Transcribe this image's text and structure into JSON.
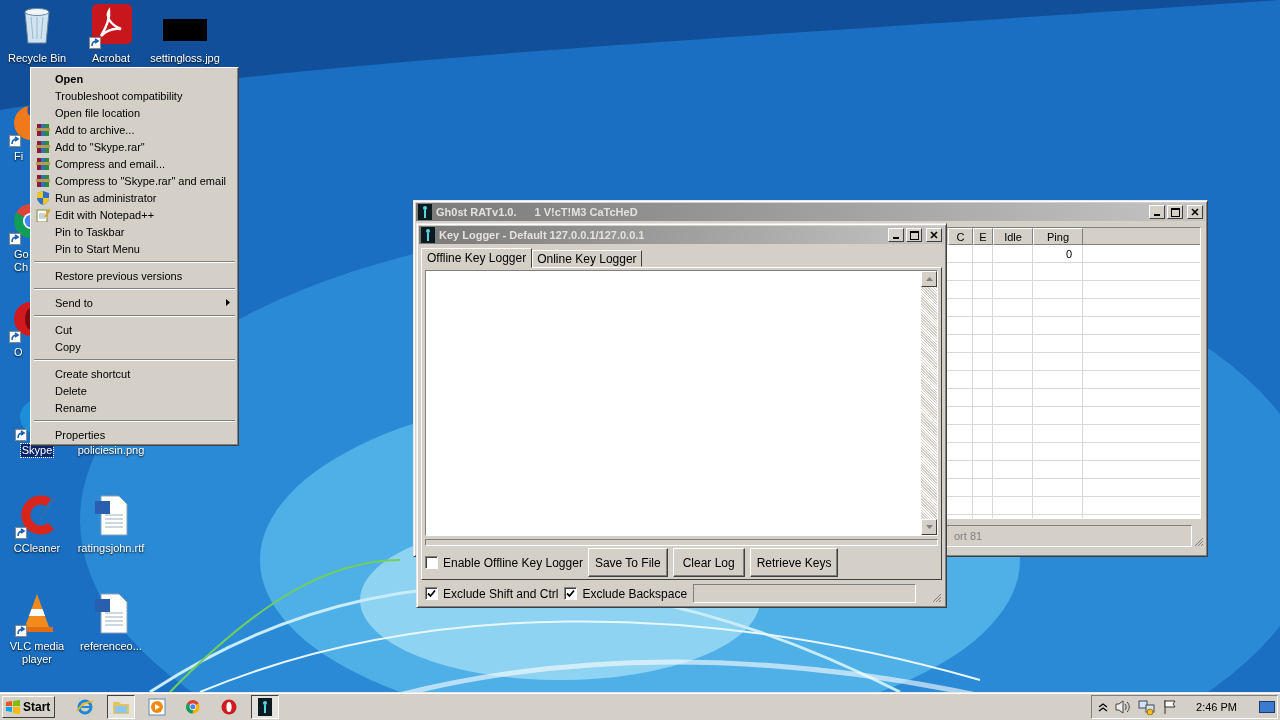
{
  "desktop": {
    "icons": [
      {
        "label": "Recycle Bin",
        "kind": "bin",
        "shortcut": false,
        "selected": false
      },
      {
        "label": "Acrobat",
        "kind": "pdf",
        "shortcut": true,
        "selected": false
      },
      {
        "label": "settingloss.jpg",
        "kind": "thumb",
        "shortcut": false,
        "selected": false
      },
      {
        "label": "Fi",
        "kind": "fox",
        "shortcut": true,
        "selected": false
      },
      {
        "label": "Go Ch",
        "kind": "chrome",
        "shortcut": true,
        "selected": false
      },
      {
        "label": "O",
        "kind": "opera",
        "shortcut": true,
        "selected": false
      },
      {
        "label": "Skype",
        "kind": "skype",
        "shortcut": true,
        "selected": true
      },
      {
        "label": "policiesin.png",
        "kind": "imagefile",
        "shortcut": false,
        "selected": false
      },
      {
        "label": "CCleaner",
        "kind": "ccleaner",
        "shortcut": true,
        "selected": false
      },
      {
        "label": "ratingsjohn.rtf",
        "kind": "document",
        "shortcut": false,
        "selected": false
      },
      {
        "label": "VLC media player",
        "kind": "cone",
        "shortcut": true,
        "selected": false
      },
      {
        "label": "referenceo...",
        "kind": "document",
        "shortcut": false,
        "selected": false
      }
    ]
  },
  "context_menu": {
    "items": [
      {
        "kind": "default",
        "label": "Open"
      },
      {
        "kind": "plain",
        "label": "Troubleshoot compatibility"
      },
      {
        "kind": "plain",
        "label": "Open file location"
      },
      {
        "kind": "archive",
        "label": "Add to archive..."
      },
      {
        "kind": "archive",
        "label": "Add to \"Skype.rar\""
      },
      {
        "kind": "archive",
        "label": "Compress and email..."
      },
      {
        "kind": "archive",
        "label": "Compress to \"Skype.rar\" and email"
      },
      {
        "kind": "elevated",
        "label": "Run as administrator"
      },
      {
        "kind": "editor",
        "label": "Edit with Notepad++"
      },
      {
        "kind": "plain",
        "label": "Pin to Taskbar"
      },
      {
        "kind": "plain",
        "label": "Pin to Start Menu"
      },
      {
        "kind": "separator"
      },
      {
        "kind": "plain",
        "label": "Restore previous versions"
      },
      {
        "kind": "separator"
      },
      {
        "kind": "submenu",
        "label": "Send to"
      },
      {
        "kind": "separator"
      },
      {
        "kind": "plain",
        "label": "Cut"
      },
      {
        "kind": "plain",
        "label": "Copy"
      },
      {
        "kind": "separator"
      },
      {
        "kind": "plain",
        "label": "Create shortcut"
      },
      {
        "kind": "plain",
        "label": "Delete"
      },
      {
        "kind": "plain",
        "label": "Rename"
      },
      {
        "kind": "separator"
      },
      {
        "kind": "plain",
        "label": "Properties"
      }
    ]
  },
  "main_window": {
    "title": "Gh0st RATv1.0.",
    "caption": "1 V!cT!M3 CaTcHeD",
    "table": {
      "columns": [
        "C",
        "E",
        "Idle",
        "Ping"
      ],
      "rows": [
        {
          "cells": [
            null,
            null,
            null,
            "0"
          ]
        }
      ]
    },
    "status_bar": "ort 81"
  },
  "keylogger_window": {
    "title": "Key Logger - Default 127.0.0.1/127.0.0.1",
    "tabs": [
      {
        "label": "Offline Key Logger",
        "selected": true
      },
      {
        "label": "Online Key Logger",
        "selected": false
      }
    ],
    "enable_checkbox": {
      "label": "Enable Offline Key Logger",
      "checked": false
    },
    "buttons": [
      "Save To File",
      "Clear Log",
      "Retrieve Keys"
    ],
    "options": [
      {
        "label": "Exclude Shift and Ctrl",
        "checked": true
      },
      {
        "label": "Exclude Backspace",
        "checked": true
      }
    ]
  },
  "taskbar": {
    "start": "Start",
    "apps": [
      {
        "kind": "web",
        "active": false
      },
      {
        "kind": "folder",
        "active": true
      },
      {
        "kind": "media",
        "active": false
      },
      {
        "kind": "chrome",
        "active": false
      },
      {
        "kind": "opera",
        "active": false
      },
      {
        "kind": "rat",
        "active": true
      }
    ],
    "clock": "2:46 PM"
  }
}
